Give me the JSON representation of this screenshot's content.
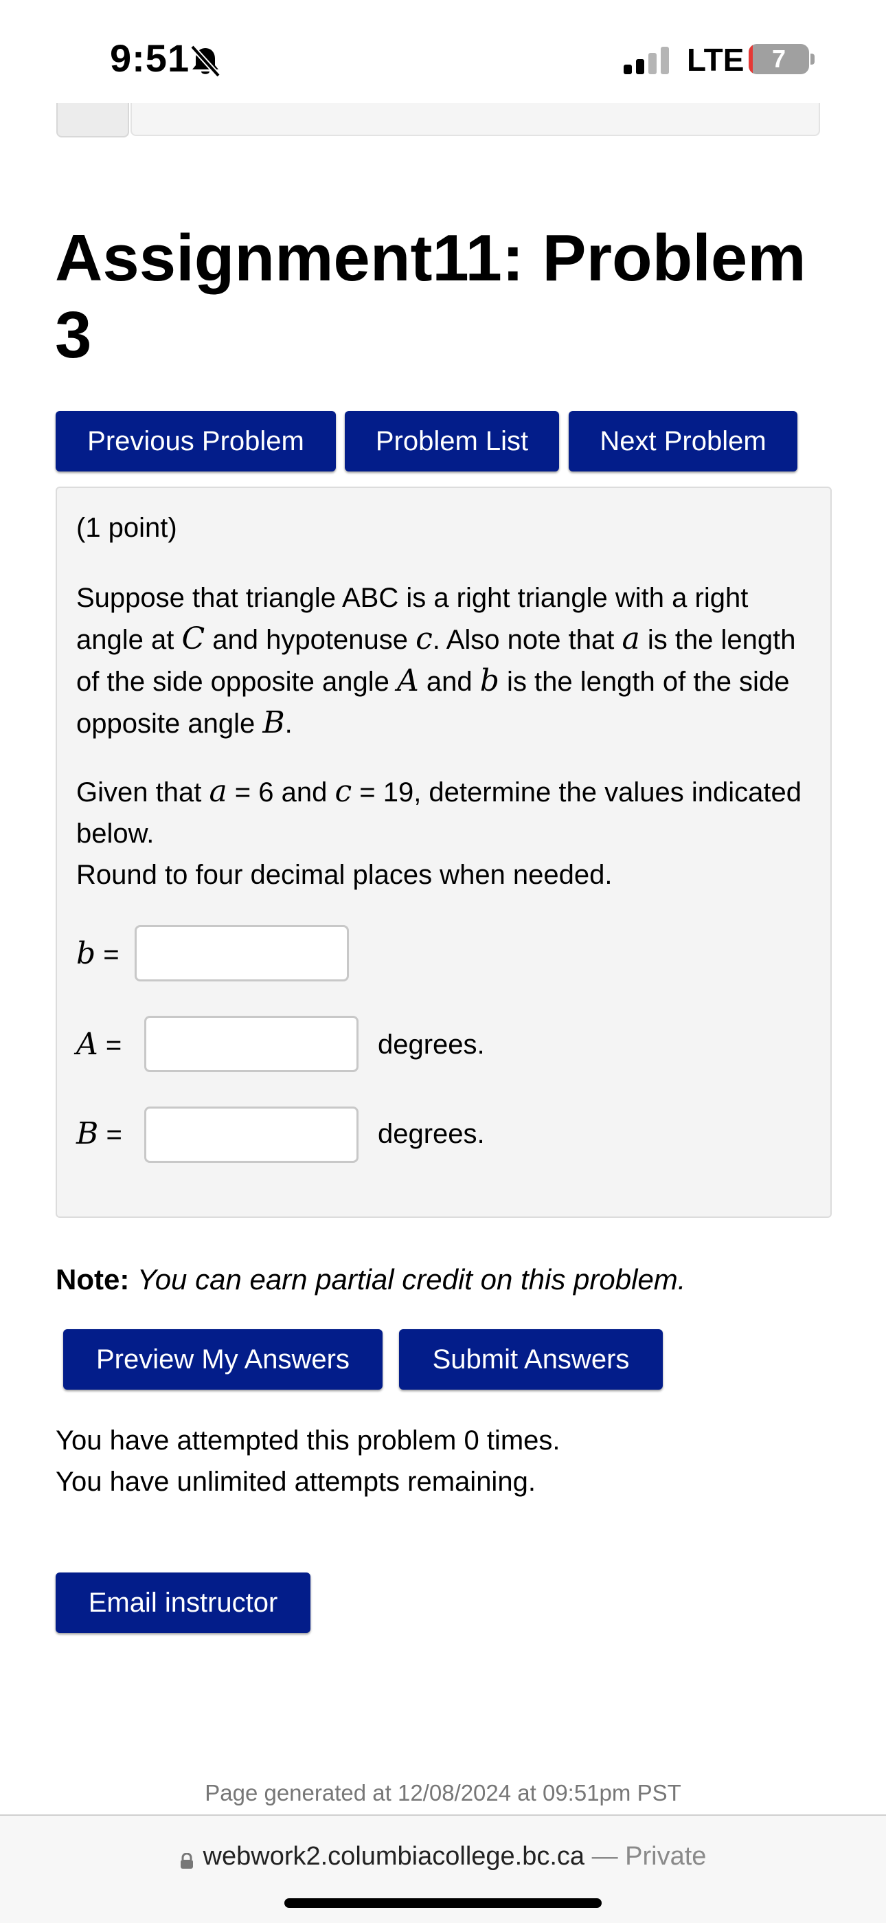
{
  "status_bar": {
    "time": "9:51",
    "network": "LTE",
    "battery_level": "7",
    "icons": [
      "bell-slash-icon",
      "signal-icon",
      "battery-icon"
    ]
  },
  "page": {
    "title": "Assignment11: Problem 3"
  },
  "nav_buttons": {
    "previous": "Previous Problem",
    "list": "Problem List",
    "next": "Next Problem"
  },
  "problem": {
    "points": "(1 point)",
    "statement": {
      "t1": "Suppose that triangle ABC is a right triangle with a right angle at ",
      "m1": "C",
      "t2": " and hypotenuse ",
      "m2": "c",
      "t3": ". Also note that ",
      "m3": "a",
      "t4": " is the length of the side opposite angle ",
      "m4": "A",
      "t5": " and ",
      "m5": "b",
      "t6": " is the length of the side opposite angle ",
      "m6": "B",
      "t7": "."
    },
    "given": {
      "t1": "Given that ",
      "m1": "a",
      "t2": " = 6 and ",
      "m2": "c",
      "t3": " = 19, determine the values indicated below.",
      "round": "Round to four decimal places when needed."
    },
    "answers": [
      {
        "var": "b",
        "eq": " =",
        "value": "",
        "unit": ""
      },
      {
        "var": "A",
        "eq": " =",
        "value": "",
        "unit": "degrees."
      },
      {
        "var": "B",
        "eq": " =",
        "value": "",
        "unit": "degrees."
      }
    ]
  },
  "note": {
    "label": "Note:",
    "text": "You can earn partial credit on this problem."
  },
  "actions": {
    "preview": "Preview My Answers",
    "submit": "Submit Answers"
  },
  "attempts": {
    "line1": "You have attempted this problem 0 times.",
    "line2": "You have unlimited attempts remaining."
  },
  "email_button": "Email instructor",
  "footer": {
    "generated": "Page generated at 12/08/2024 at 09:51pm PST"
  },
  "browser": {
    "domain": "webwork2.columbiacollege.bc.ca",
    "suffix": " — Private"
  },
  "colors": {
    "button_bg": "#031d8a",
    "problem_bg": "#f4f4f4",
    "battery_low": "#e53935"
  }
}
